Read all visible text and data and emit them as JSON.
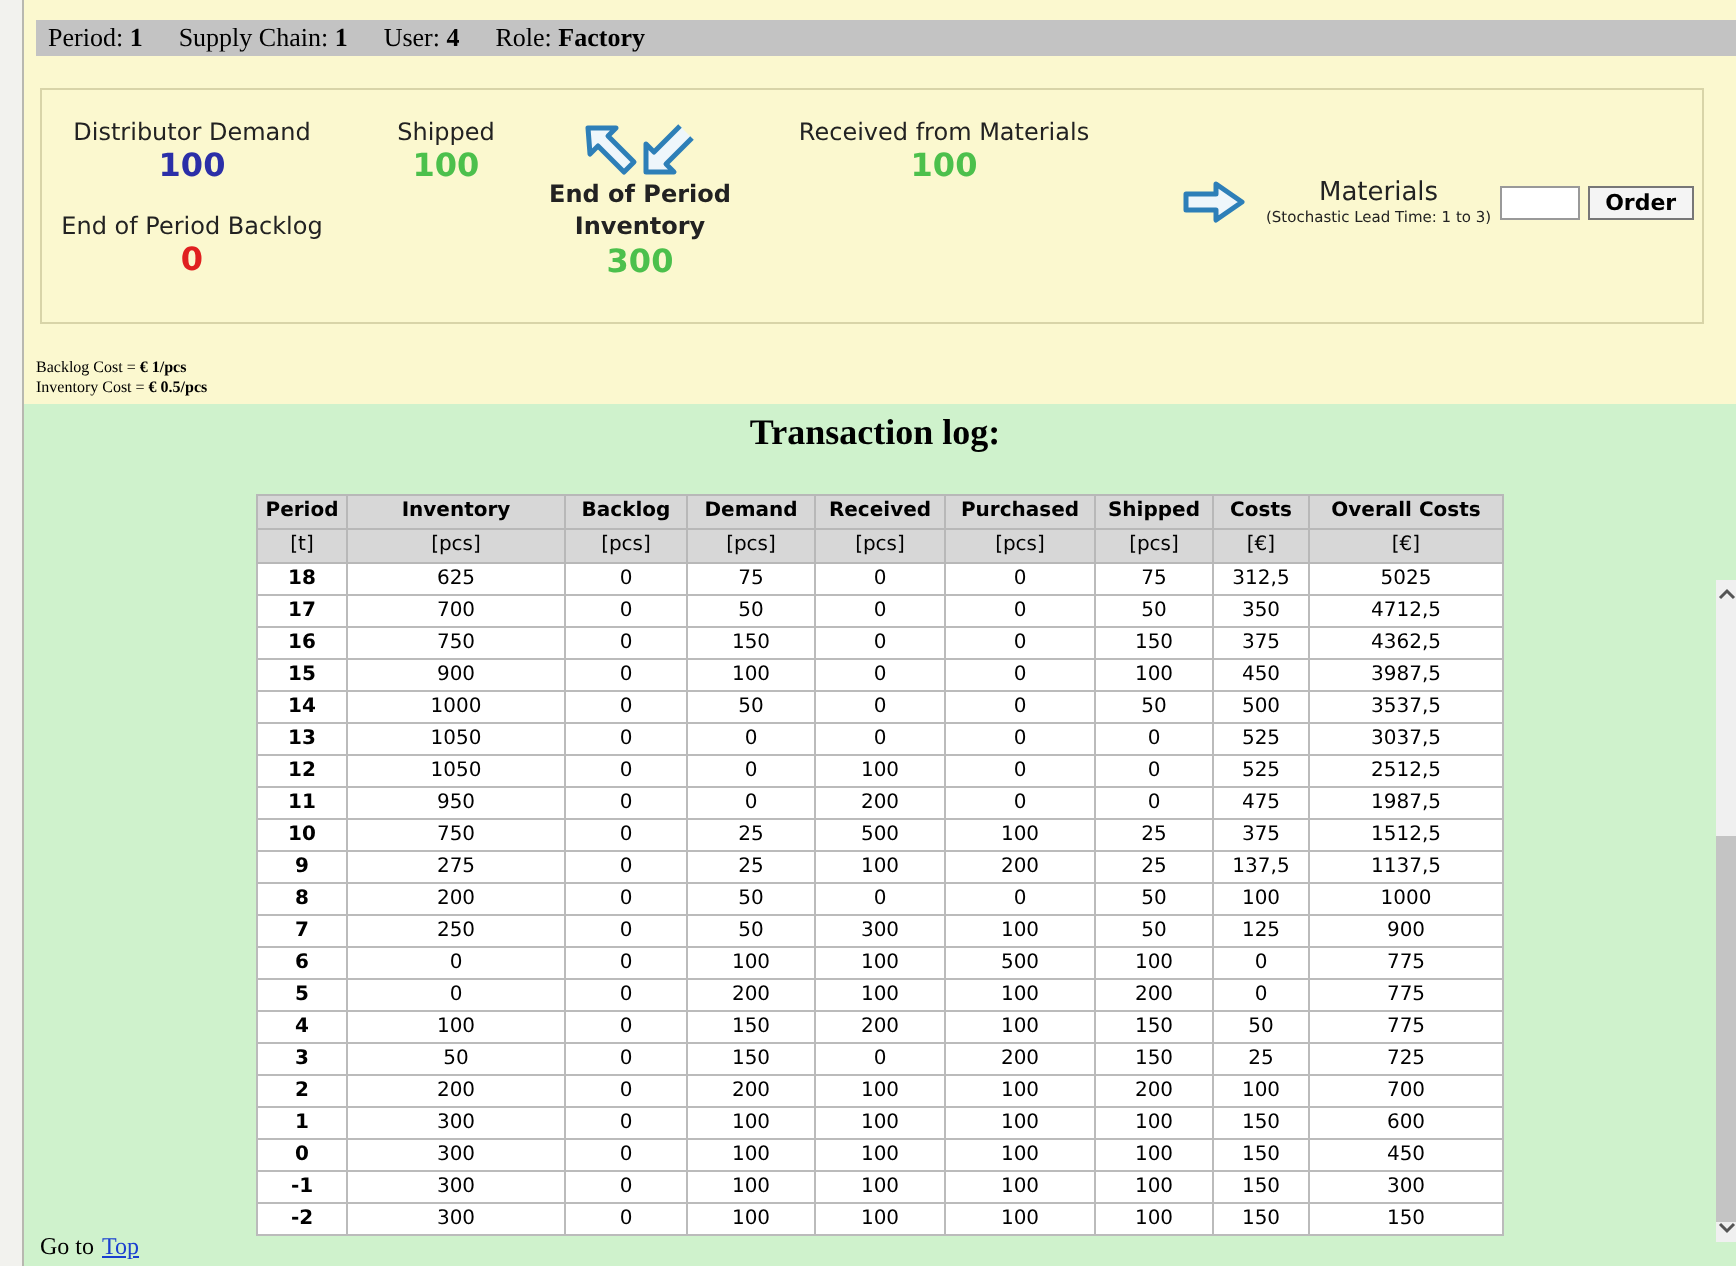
{
  "info_bar": [
    {
      "label": "Period:",
      "value": "1"
    },
    {
      "label": "Supply Chain:",
      "value": "1"
    },
    {
      "label": "User:",
      "value": "4"
    },
    {
      "label": "Role:",
      "value": "Factory"
    }
  ],
  "stats": [
    {
      "label": "Distributor Demand",
      "value": "100",
      "color": "#2b2fa8"
    },
    {
      "label": "End of Period Backlog",
      "value": "0",
      "color": "#e02020"
    },
    {
      "label": "Shipped",
      "value": "100",
      "color": "#4cc04c"
    },
    {
      "label": "End of Period Inventory",
      "value": "300",
      "color": "#4cc04c"
    },
    {
      "label": "Received from Materials",
      "value": "100",
      "color": "#4cc04c"
    }
  ],
  "order": {
    "title": "Materials",
    "note": "(Stochastic Lead Time: 1 to 3)",
    "button": "Order"
  },
  "costs": [
    "Backlog Cost = **€ 1/pcs**",
    "Inventory Cost = **€ 0.5/pcs**"
  ],
  "log_title": "Transaction log:",
  "table": {
    "columns": [
      {
        "name": "Period",
        "unit": "[t]"
      },
      {
        "name": "Inventory",
        "unit": "[pcs]"
      },
      {
        "name": "Backlog",
        "unit": "[pcs]"
      },
      {
        "name": "Demand",
        "unit": "[pcs]"
      },
      {
        "name": "Received",
        "unit": "[pcs]"
      },
      {
        "name": "Purchased",
        "unit": "[pcs]"
      },
      {
        "name": "Shipped",
        "unit": "[pcs]"
      },
      {
        "name": "Costs",
        "unit": "[€]"
      },
      {
        "name": "Overall Costs",
        "unit": "[€]"
      }
    ],
    "rows": [
      [
        "18",
        "625",
        "0",
        "75",
        "0",
        "0",
        "75",
        "312,5",
        "5025"
      ],
      [
        "17",
        "700",
        "0",
        "50",
        "0",
        "0",
        "50",
        "350",
        "4712,5"
      ],
      [
        "16",
        "750",
        "0",
        "150",
        "0",
        "0",
        "150",
        "375",
        "4362,5"
      ],
      [
        "15",
        "900",
        "0",
        "100",
        "0",
        "0",
        "100",
        "450",
        "3987,5"
      ],
      [
        "14",
        "1000",
        "0",
        "50",
        "0",
        "0",
        "50",
        "500",
        "3537,5"
      ],
      [
        "13",
        "1050",
        "0",
        "0",
        "0",
        "0",
        "0",
        "525",
        "3037,5"
      ],
      [
        "12",
        "1050",
        "0",
        "0",
        "100",
        "0",
        "0",
        "525",
        "2512,5"
      ],
      [
        "11",
        "950",
        "0",
        "0",
        "200",
        "0",
        "0",
        "475",
        "1987,5"
      ],
      [
        "10",
        "750",
        "0",
        "25",
        "500",
        "100",
        "25",
        "375",
        "1512,5"
      ],
      [
        "9",
        "275",
        "0",
        "25",
        "100",
        "200",
        "25",
        "137,5",
        "1137,5"
      ],
      [
        "8",
        "200",
        "0",
        "50",
        "0",
        "0",
        "50",
        "100",
        "1000"
      ],
      [
        "7",
        "250",
        "0",
        "50",
        "300",
        "100",
        "50",
        "125",
        "900"
      ],
      [
        "6",
        "0",
        "0",
        "100",
        "100",
        "500",
        "100",
        "0",
        "775"
      ],
      [
        "5",
        "0",
        "0",
        "200",
        "100",
        "100",
        "200",
        "0",
        "775"
      ],
      [
        "4",
        "100",
        "0",
        "150",
        "200",
        "100",
        "150",
        "50",
        "775"
      ],
      [
        "3",
        "50",
        "0",
        "150",
        "0",
        "200",
        "150",
        "25",
        "725"
      ],
      [
        "2",
        "200",
        "0",
        "200",
        "100",
        "100",
        "200",
        "100",
        "700"
      ],
      [
        "1",
        "300",
        "0",
        "100",
        "100",
        "100",
        "100",
        "150",
        "600"
      ],
      [
        "0",
        "300",
        "0",
        "100",
        "100",
        "100",
        "100",
        "150",
        "450"
      ],
      [
        "-1",
        "300",
        "0",
        "100",
        "100",
        "100",
        "100",
        "150",
        "300"
      ],
      [
        "-2",
        "300",
        "0",
        "100",
        "100",
        "100",
        "100",
        "150",
        "150"
      ]
    ]
  },
  "footer_link": {
    "label": "Go to",
    "link": "Top"
  }
}
